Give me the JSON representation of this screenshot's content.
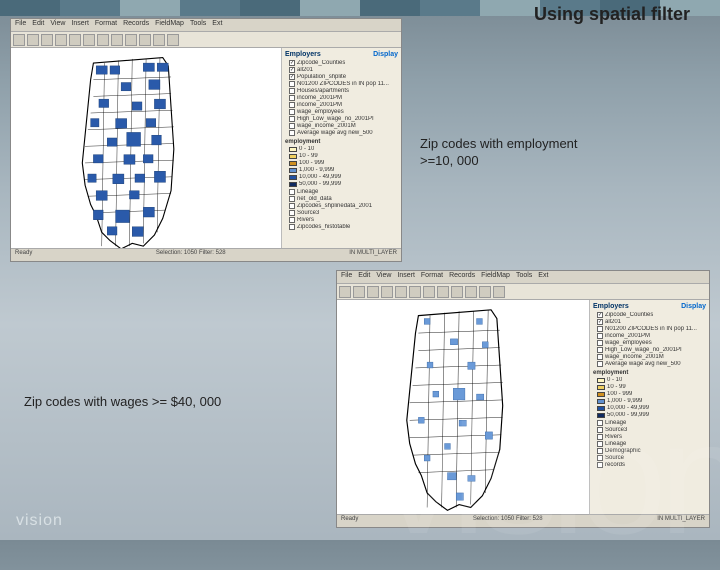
{
  "slide": {
    "title": "Using spatial filter",
    "caption1_line1": "Zip codes with employment",
    "caption1_line2": ">=10, 000",
    "caption2": "Zip codes with wages >= $40, 000",
    "brand": "vision",
    "watermark": "vision"
  },
  "gis": {
    "menu": [
      "File",
      "Edit",
      "View",
      "Insert",
      "Format",
      "Records",
      "FieldMap",
      "Tools",
      "Ext"
    ],
    "panel_header": "Employers",
    "panel_link": "Display",
    "status_left": "Ready",
    "status_mid": "Selection: 1050  Filter: 528",
    "status_right": "IN MULTI_LAYER",
    "layers": [
      {
        "label": "Zipcode_Counties",
        "checked": true,
        "indent": 0
      },
      {
        "label": "all201",
        "checked": true,
        "indent": 1
      },
      {
        "label": "Population_shplite",
        "checked": true,
        "indent": 1
      },
      {
        "label": "N01200 ZIPCODES in IN pop 11...",
        "checked": false,
        "indent": 1
      },
      {
        "label": "Houses/apartments",
        "checked": false,
        "indent": 1
      },
      {
        "label": "income_2001PM",
        "checked": false,
        "indent": 1
      },
      {
        "label": "income_2001PM",
        "checked": false,
        "indent": 1
      },
      {
        "label": "wage_employees",
        "checked": false,
        "indent": 1
      },
      {
        "label": "High_Low_wage_no_2001PI",
        "checked": false,
        "indent": 1
      },
      {
        "label": "wage_income_2001M",
        "checked": false,
        "indent": 1
      },
      {
        "label": "Average wage avg new_500",
        "checked": false,
        "indent": 1
      }
    ],
    "legend_title": "employment",
    "legend": [
      {
        "label": "0 - 10",
        "color": "#fff7c0"
      },
      {
        "label": "10 - 99",
        "color": "#f0d060"
      },
      {
        "label": "100 - 999",
        "color": "#d09020"
      },
      {
        "label": "1,000 - 9,999",
        "color": "#6090d0"
      },
      {
        "label": "10,000 - 49,999",
        "color": "#2050a0"
      },
      {
        "label": "50,000 - 99,999",
        "color": "#102a60"
      }
    ],
    "extra": [
      "Lineage",
      "net_old_data",
      "Zipcodes_shplinedata_2001",
      "Source3",
      "Rivers",
      "Zipcodes_histotable",
      "Lineage",
      "Demographic",
      "Source",
      "records"
    ]
  }
}
